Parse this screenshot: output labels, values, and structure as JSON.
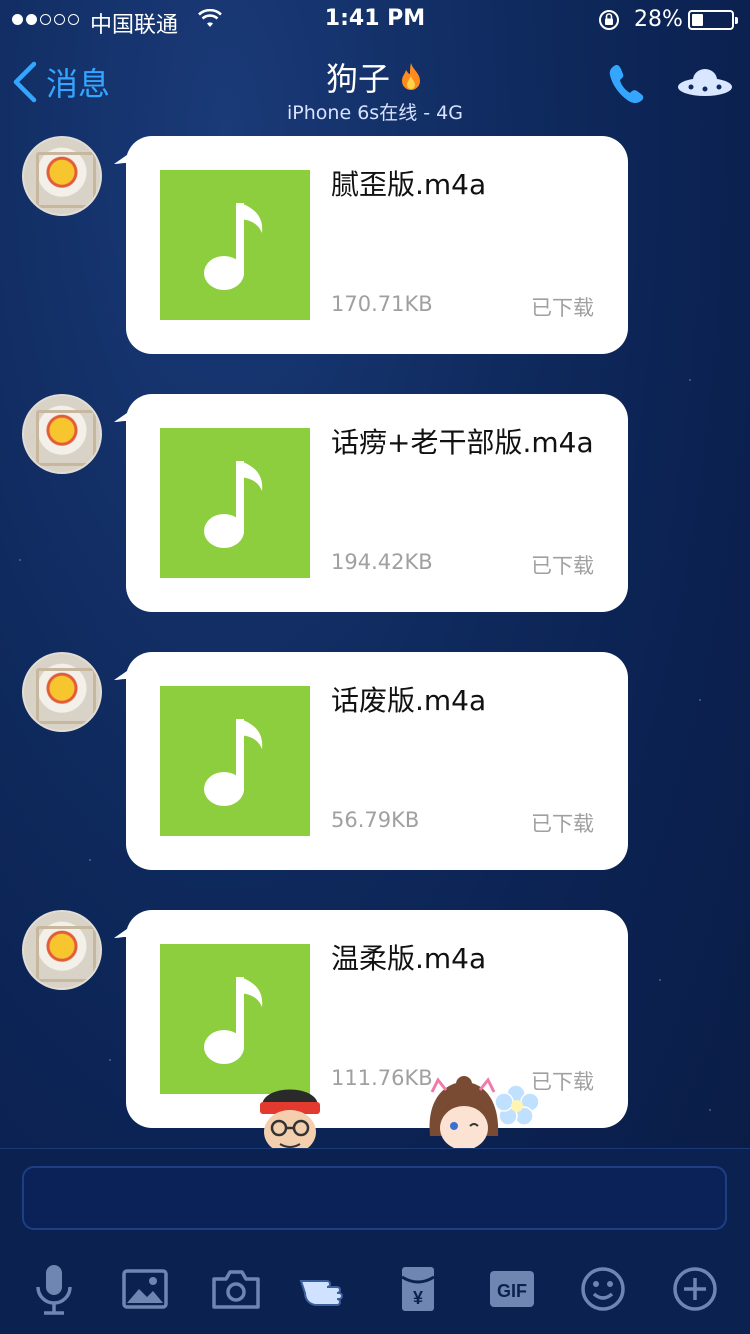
{
  "status_bar": {
    "carrier": "中国联通",
    "time": "1:41 PM",
    "battery_percent": "28%",
    "battery_level": 0.28,
    "signal_bars_filled": 2,
    "signal_bars_total": 5
  },
  "nav": {
    "back_label": "消息",
    "contact_name": "狗子",
    "contact_status": "iPhone 6s在线 - 4G",
    "accent_color": "#34a6ff"
  },
  "messages": [
    {
      "file_name": "腻歪版.m4a",
      "file_size": "170.71KB",
      "status": "已下载"
    },
    {
      "file_name": "话痨+老干部版.m4a",
      "file_size": "194.42KB",
      "status": "已下载"
    },
    {
      "file_name": "话废版.m4a",
      "file_size": "56.79KB",
      "status": "已下载"
    },
    {
      "file_name": "温柔版.m4a",
      "file_size": "111.76KB",
      "status": "已下载"
    }
  ],
  "file_icon_color": "#8cce3e",
  "toolbar": {
    "items": [
      "microphone-icon",
      "image-icon",
      "camera-icon",
      "poke-hand-icon",
      "red-packet-icon",
      "gif-icon",
      "emoji-icon",
      "plus-icon"
    ],
    "gif_label": "GIF",
    "red_packet_label": "¥"
  }
}
